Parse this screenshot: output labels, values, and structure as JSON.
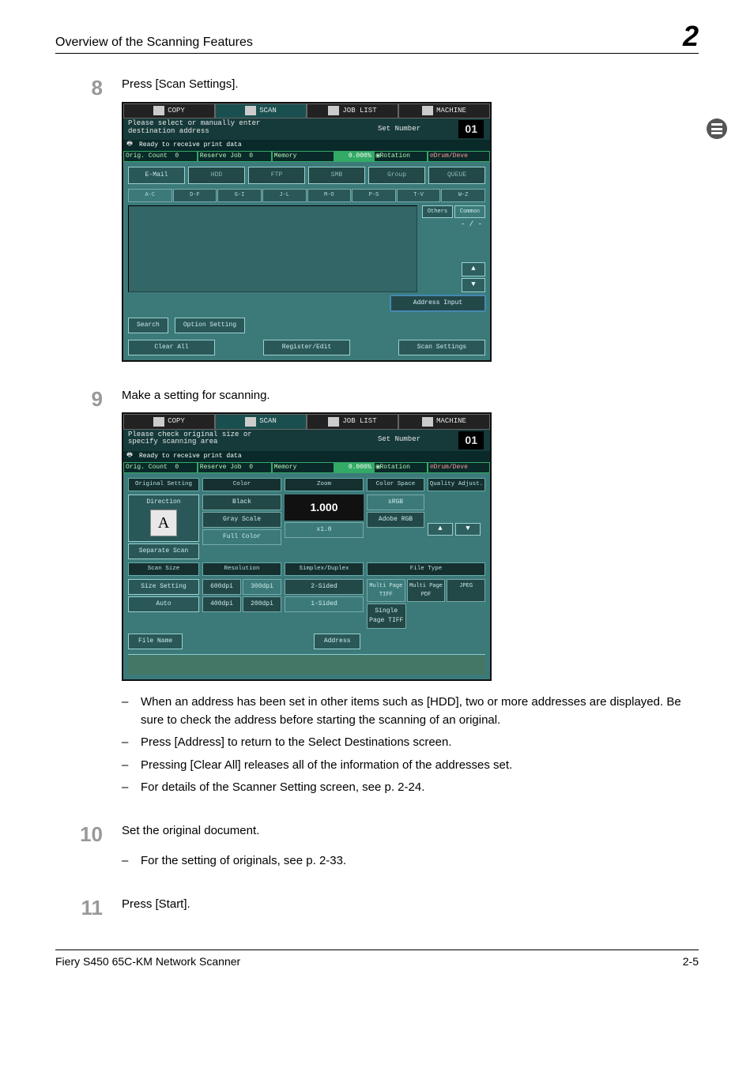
{
  "header": {
    "title": "Overview of the Scanning Features",
    "chapter_number": "2"
  },
  "steps": {
    "s8": {
      "num": "8",
      "text": "Press [Scan Settings].",
      "screenshot_selectdest": {
        "tabs": [
          "COPY",
          "SCAN",
          "JOB LIST",
          "MACHINE"
        ],
        "msg_line1": "Please select or manually enter",
        "msg_line2": "destination address",
        "set_number_label": "Set Number",
        "set_number_value": "01",
        "ready_text": "Ready to receive print data",
        "status": {
          "orig_count": "Orig. Count",
          "orig_count_val": "0",
          "reserve": "Reserve Job",
          "reserve_val": "0",
          "memory": "Memory",
          "memory_pct": "0.000%",
          "rotation": "Rotation",
          "drum": "Drum/Deve"
        },
        "cat_buttons": [
          "E-Mail",
          "HDD",
          "FTP",
          "SMB",
          "Group",
          "QUEUE"
        ],
        "alpha_tabs": [
          "A-C",
          "D-F",
          "G-I",
          "J-L",
          "M-O",
          "P-S",
          "T-V",
          "W-Z"
        ],
        "side": {
          "others": "Others",
          "common": "Common",
          "pager": "- / -",
          "up": "▲",
          "down": "▼"
        },
        "address_input": "Address Input",
        "bottom": {
          "search": "Search",
          "option_setting": "Option Setting",
          "clear_all": "Clear All",
          "register_edit": "Register/Edit",
          "scan_settings": "Scan Settings"
        }
      }
    },
    "s9": {
      "num": "9",
      "text": "Make a setting for scanning.",
      "screenshot_scanset": {
        "tabs": [
          "COPY",
          "SCAN",
          "JOB LIST",
          "MACHINE"
        ],
        "msg_line1": "Please check original size or",
        "msg_line2": "specify scanning area",
        "set_number_label": "Set Number",
        "set_number_value": "01",
        "ready_text": "Ready to receive print data",
        "status": {
          "orig_count": "Orig. Count",
          "orig_count_val": "0",
          "reserve": "Reserve Job",
          "reserve_val": "0",
          "memory": "Memory",
          "memory_pct": "0.000%",
          "rotation": "Rotation",
          "drum": "Drum/Deve"
        },
        "headers": [
          "Original Setting",
          "Color",
          "Zoom",
          "Color Space",
          "Quality Adjust."
        ],
        "col1": {
          "direction_label": "Direction",
          "direction_glyph": "A",
          "separate_scan": "Separate Scan",
          "scan_size_hdr": "Scan Size",
          "size_setting": "Size Setting",
          "auto": "Auto"
        },
        "col2": {
          "color_opts": [
            "Black",
            "Gray Scale",
            "Full Color"
          ],
          "resolution_hdr": "Resolution",
          "res_opts": [
            "600dpi",
            "300dpi",
            "400dpi",
            "200dpi"
          ]
        },
        "col3": {
          "zoom_value": "1.000",
          "x1": "x1.0",
          "sd_hdr": "Simplex/Duplex",
          "sd_opts": [
            "2-Sided",
            "1-Sided"
          ]
        },
        "col4": {
          "cspace_opts": [
            "sRGB",
            "Adobe RGB"
          ],
          "arrows": [
            "▲",
            "▼"
          ],
          "ft_hdr": "File Type",
          "ft_opts": [
            "Multi Page TIFF",
            "Multi Page PDF",
            "JPEG",
            "Single Page TIFF"
          ]
        },
        "filename": "File Name",
        "address": "Address"
      },
      "bullets": [
        "When an address has been set in other items such as [HDD], two or more addresses are displayed. Be sure to check the address before starting the scanning of an original.",
        "Press [Address] to return to the Select Destinations screen.",
        "Pressing [Clear All] releases all of the information of the addresses set.",
        "For details of the Scanner Setting screen, see p. 2-24."
      ]
    },
    "s10": {
      "num": "10",
      "text": "Set the original document.",
      "bullets": [
        "For the setting of originals, see p. 2-33."
      ]
    },
    "s11": {
      "num": "11",
      "text": "Press [Start]."
    }
  },
  "footer": {
    "left": "Fiery S450 65C-KM Network Scanner",
    "right": "2-5"
  }
}
